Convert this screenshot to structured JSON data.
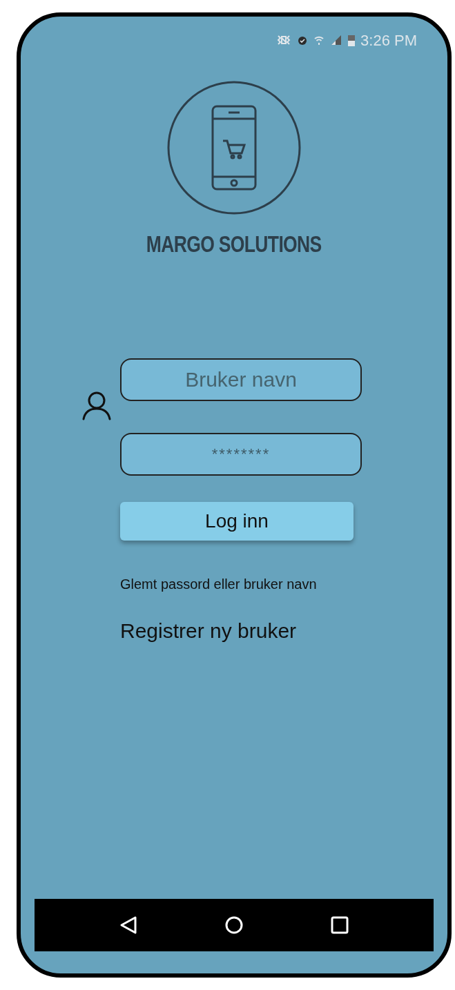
{
  "status_bar": {
    "time": "3:26 PM"
  },
  "brand": {
    "name": "MARGO SOLUTIONS"
  },
  "login_form": {
    "username": {
      "placeholder": "Bruker navn"
    },
    "password": {
      "value": "********"
    },
    "submit": "Log inn",
    "forgot_link": "Glemt passord eller bruker navn",
    "register_link": "Registrer ny bruker"
  }
}
